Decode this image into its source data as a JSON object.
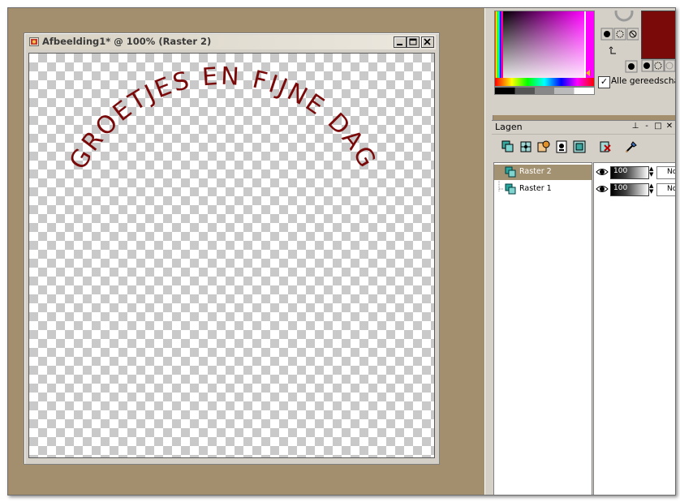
{
  "image_window": {
    "title": "Afbeelding1* @ 100% (Raster 2)",
    "canvas_text": "GROETJES EN FIJNE DAG",
    "text_color": "#7a0a0a"
  },
  "materials": {
    "all_tools_label": "Alle gereedschap",
    "all_tools_checked": "✓",
    "foreground_color": "#7a0a0a"
  },
  "layers_panel": {
    "title": "Lagen",
    "pin_glyph": "⊥",
    "minimize_glyph": "-",
    "maximize_glyph": "□",
    "close_glyph": "✕",
    "layers": [
      {
        "name": "Raster 2",
        "opacity": "100",
        "blend": "No",
        "selected": true
      },
      {
        "name": "Raster 1",
        "opacity": "100",
        "blend": "No",
        "selected": false
      }
    ]
  }
}
